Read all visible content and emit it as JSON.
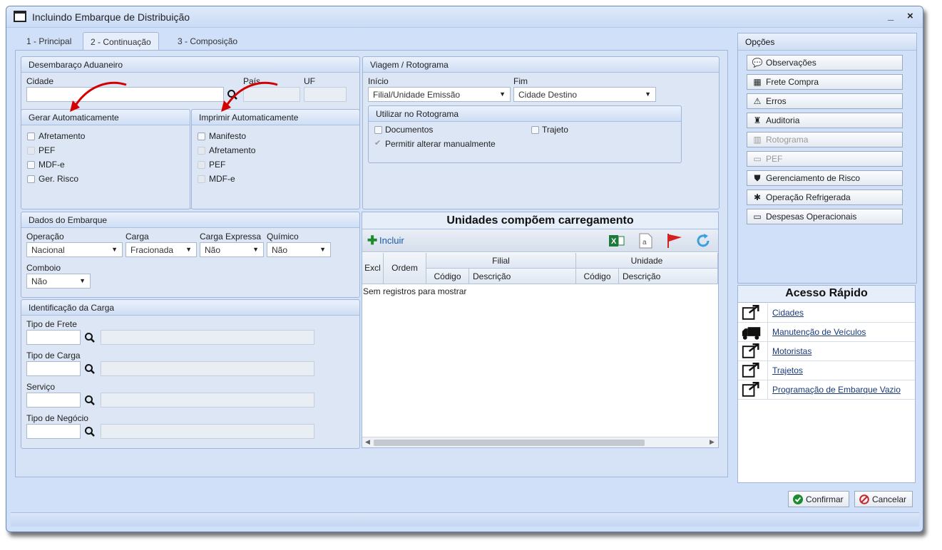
{
  "window": {
    "title": "Incluindo Embarque de Distribuição",
    "minimize": "_",
    "close": "×"
  },
  "tabs": [
    {
      "label": "1 - Principal"
    },
    {
      "label": "2 - Continuação",
      "active": true
    },
    {
      "label": "3 - Composição"
    }
  ],
  "desembaraco": {
    "title": "Desembaraço Aduaneiro",
    "cidade_label": "Cidade",
    "cidade_value": "",
    "pais_label": "País",
    "uf_label": "UF"
  },
  "gerar": {
    "title": "Gerar Automaticamente",
    "items": [
      {
        "label": "Afretamento",
        "checked": false,
        "disabled": false
      },
      {
        "label": "PEF",
        "checked": false,
        "disabled": true
      },
      {
        "label": "MDF-e",
        "checked": false,
        "disabled": false
      },
      {
        "label": "Ger. Risco",
        "checked": false,
        "disabled": false
      }
    ]
  },
  "imprimir": {
    "title": "Imprimir Automaticamente",
    "items": [
      {
        "label": "Manifesto",
        "checked": false,
        "disabled": false
      },
      {
        "label": "Afretamento",
        "checked": false,
        "disabled": true
      },
      {
        "label": "PEF",
        "checked": false,
        "disabled": true
      },
      {
        "label": "MDF-e",
        "checked": false,
        "disabled": true
      }
    ]
  },
  "viagem": {
    "title": "Viagem / Rotograma",
    "inicio_label": "Início",
    "inicio_value": "Filial/Unidade Emissão",
    "fim_label": "Fim",
    "fim_value": "Cidade Destino",
    "rotograma_title": "Utilizar no Rotograma",
    "documentos": "Documentos",
    "trajeto": "Trajeto",
    "permitir": "Permitir alterar manualmente"
  },
  "dados": {
    "title": "Dados do Embarque",
    "operacao_label": "Operação",
    "operacao_value": "Nacional",
    "carga_label": "Carga",
    "carga_value": "Fracionada",
    "carga_expressa_label": "Carga Expressa",
    "carga_expressa_value": "Não",
    "quimico_label": "Químico",
    "quimico_value": "Não",
    "comboio_label": "Comboio",
    "comboio_value": "Não"
  },
  "identificacao": {
    "title": "Identificação da Carga",
    "tipo_frete": "Tipo de Frete",
    "tipo_carga": "Tipo de Carga",
    "servico": "Serviço",
    "tipo_negocio": "Tipo de Negócio"
  },
  "grid": {
    "title": "Unidades compõem carregamento",
    "incluir": "Incluir",
    "excl": "Excl",
    "ordem": "Ordem",
    "filial": "Filial",
    "unidade": "Unidade",
    "codigo": "Código",
    "descricao": "Descrição",
    "empty": "Sem registros para mostrar"
  },
  "opcoes": {
    "title": "Opções",
    "items": [
      {
        "label": "Observações",
        "icon": "comment-icon"
      },
      {
        "label": "Frete Compra",
        "icon": "calculator-icon"
      },
      {
        "label": "Erros",
        "icon": "warning-icon"
      },
      {
        "label": "Auditoria",
        "icon": "auditor-icon"
      },
      {
        "label": "Rotograma",
        "icon": "map-icon",
        "disabled": true
      },
      {
        "label": "PEF",
        "icon": "money-icon",
        "disabled": true
      },
      {
        "label": "Gerenciamento de Risco",
        "icon": "shield-icon"
      },
      {
        "label": "Operação Refrigerada",
        "icon": "snowflake-icon"
      },
      {
        "label": "Despesas Operacionais",
        "icon": "money-icon"
      }
    ]
  },
  "acesso": {
    "title": "Acesso Rápido",
    "items": [
      {
        "label": "Cidades",
        "icon": "external-link-icon"
      },
      {
        "label": "Manutenção de Veículos",
        "icon": "truck-icon"
      },
      {
        "label": "Motoristas",
        "icon": "external-link-icon"
      },
      {
        "label": "Trajetos",
        "icon": "external-link-icon"
      },
      {
        "label": "Programação de Embarque Vazio",
        "icon": "external-link-icon"
      }
    ]
  },
  "footer": {
    "confirmar": "Confirmar",
    "cancelar": "Cancelar"
  },
  "colors": {
    "accent_green": "#1e8a2e",
    "error_red": "#c62828",
    "link": "#1a3a7a"
  }
}
